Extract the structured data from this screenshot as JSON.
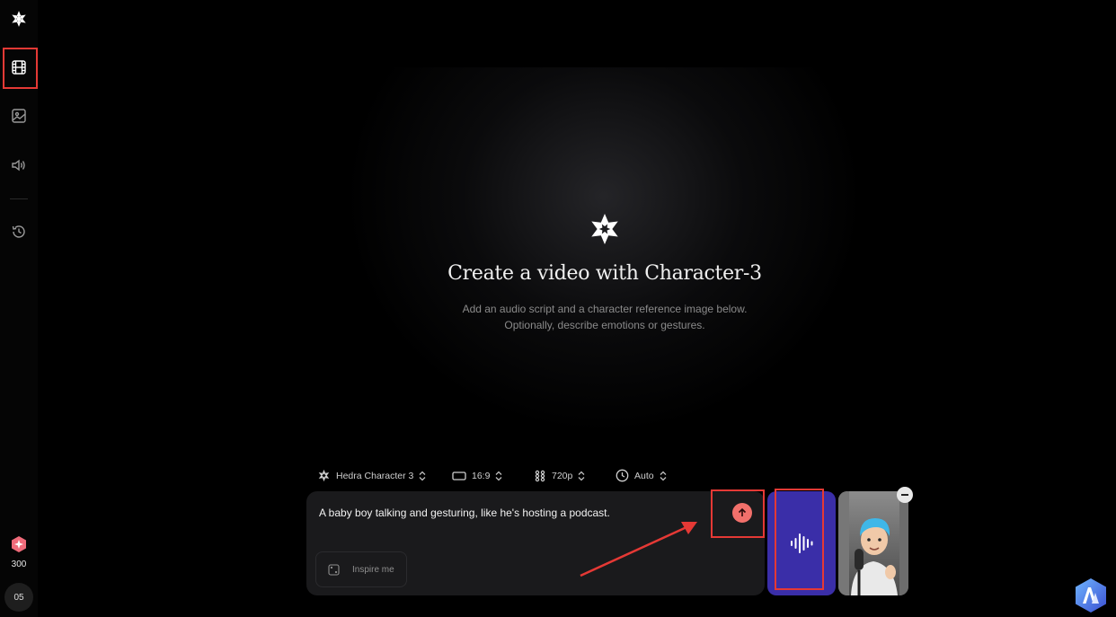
{
  "sidebar": {
    "items": [
      {
        "icon": "hedra-logo-icon"
      },
      {
        "icon": "film-icon",
        "label": "video"
      },
      {
        "icon": "image-icon",
        "label": "image"
      },
      {
        "icon": "speaker-icon",
        "label": "audio"
      },
      {
        "icon": "history-icon",
        "label": "history"
      }
    ],
    "credits": "300",
    "avatar": "05"
  },
  "hero": {
    "title": "Create a video with Character-3",
    "subtitle_line1": "Add an audio script and a character reference image below.",
    "subtitle_line2": "Optionally, describe emotions or gestures."
  },
  "options": {
    "model": "Hedra Character 3",
    "aspect_ratio": "16:9",
    "resolution": "720p",
    "duration": "Auto"
  },
  "composer": {
    "prompt": "A baby boy talking and gesturing, like he's hosting a podcast.",
    "inspire_label": "Inspire me"
  },
  "colors": {
    "accent_send": "#f2706b",
    "audio_card": "#3a2ea8",
    "highlight": "#e53935"
  }
}
